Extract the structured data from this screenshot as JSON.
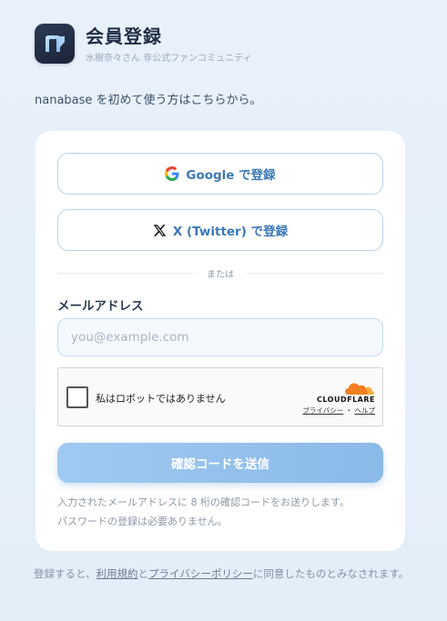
{
  "header": {
    "title": "会員登録",
    "subtitle": "水樹奈々さん 非公式ファンコミュニティ"
  },
  "intro": "nanabase を初めて使う方はこちらから。",
  "oauth": {
    "google_label": "Google で登録",
    "x_label": "X (Twitter) で登録"
  },
  "divider": "または",
  "email": {
    "label": "メールアドレス",
    "value": "",
    "placeholder": "you@example.com"
  },
  "captcha": {
    "label": "私はロボットではありません",
    "brand": "CLOUDFLARE",
    "privacy_link": "プライバシー",
    "separator": "・",
    "help_link": "ヘルプ"
  },
  "submit_label": "確認コードを送信",
  "note": {
    "line1": "入力されたメールアドレスに 8 桁の確認コードをお送りします。",
    "line2": "パスワードの登録は必要ありません。"
  },
  "terms": {
    "prefix": "登録すると、",
    "terms_link": "利用規約",
    "and": "と",
    "privacy_link": "プライバシーポリシー",
    "suffix": "に同意したものとみなされます。"
  },
  "colors": {
    "accent": "#3c78b5",
    "submit": "#9fcaf1",
    "logo_bg": "#1f2a3f",
    "cloudflare": "#f38020"
  }
}
